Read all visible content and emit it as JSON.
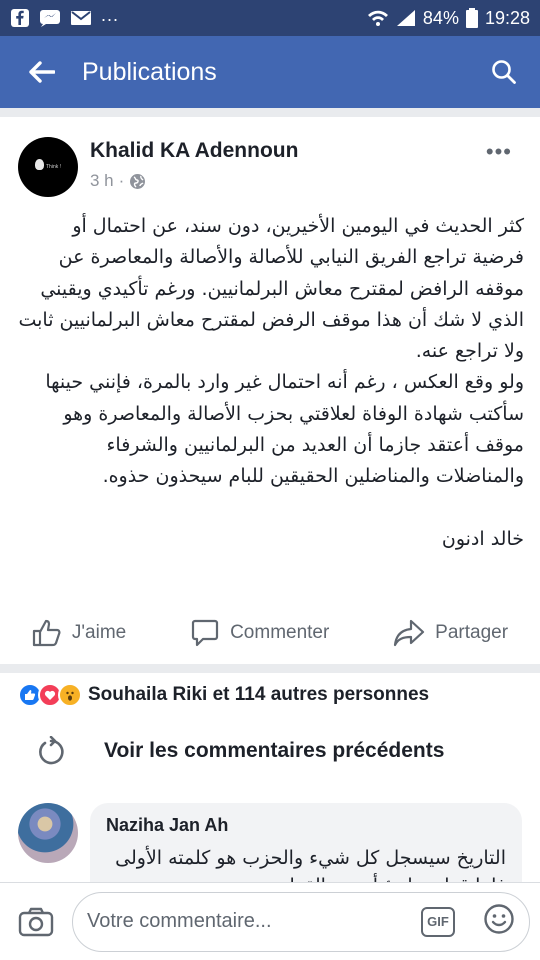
{
  "status_bar": {
    "dots": "...",
    "battery": "84%",
    "time": "19:28"
  },
  "app_bar": {
    "title": "Publications"
  },
  "post": {
    "author": "Khalid KA Adennoun",
    "time": "3 h",
    "separator": "·",
    "avatar_text": "Think !",
    "more": "•••",
    "paragraph1": "كثر الحديث في اليومين الأخيرين، دون سند، عن احتمال أو فرضية تراجع الفريق النيابي للأصالة والأصالة والمعاصرة عن موقفه الرافض لمقترح معاش البرلمانيين. ورغم تأكيدي ويقيني الذي لا شك أن هذا موقف الرفض لمقترح معاش البرلمانيين ثابت ولا تراجع عنه.",
    "paragraph2": "ولو وقع العكس ، رغم أنه احتمال غير وارد بالمرة، فإنني حينها سأكتب شهادة الوفاة لعلاقتي بحزب الأصالة والمعاصرة وهو موقف أعتقد جازما أن العديد من البرلمانيين والشرفاء والمناضلات والمناضلين الحقيقين للبام سيحذون حذوه.",
    "signature": "خالد ادنون",
    "actions": {
      "like": "J'aime",
      "comment": "Commenter",
      "share": "Partager"
    }
  },
  "reactions": {
    "text": "Souhaila Riki et 114 autres personnes"
  },
  "previous_comments": {
    "label": "Voir les commentaires précédents"
  },
  "comment": {
    "author": "Naziha Jan Ah",
    "text": "التاريخ سيسجل كل شيء والحزب هو كلمته الأولى فإما قرار مبادئ أو بين القرار"
  },
  "composer": {
    "placeholder": "Votre commentaire...",
    "gif": "GIF"
  },
  "colors": {
    "brand": "#4267b2",
    "status": "#2d4373",
    "text": "#1d2129",
    "muted": "#606770"
  }
}
